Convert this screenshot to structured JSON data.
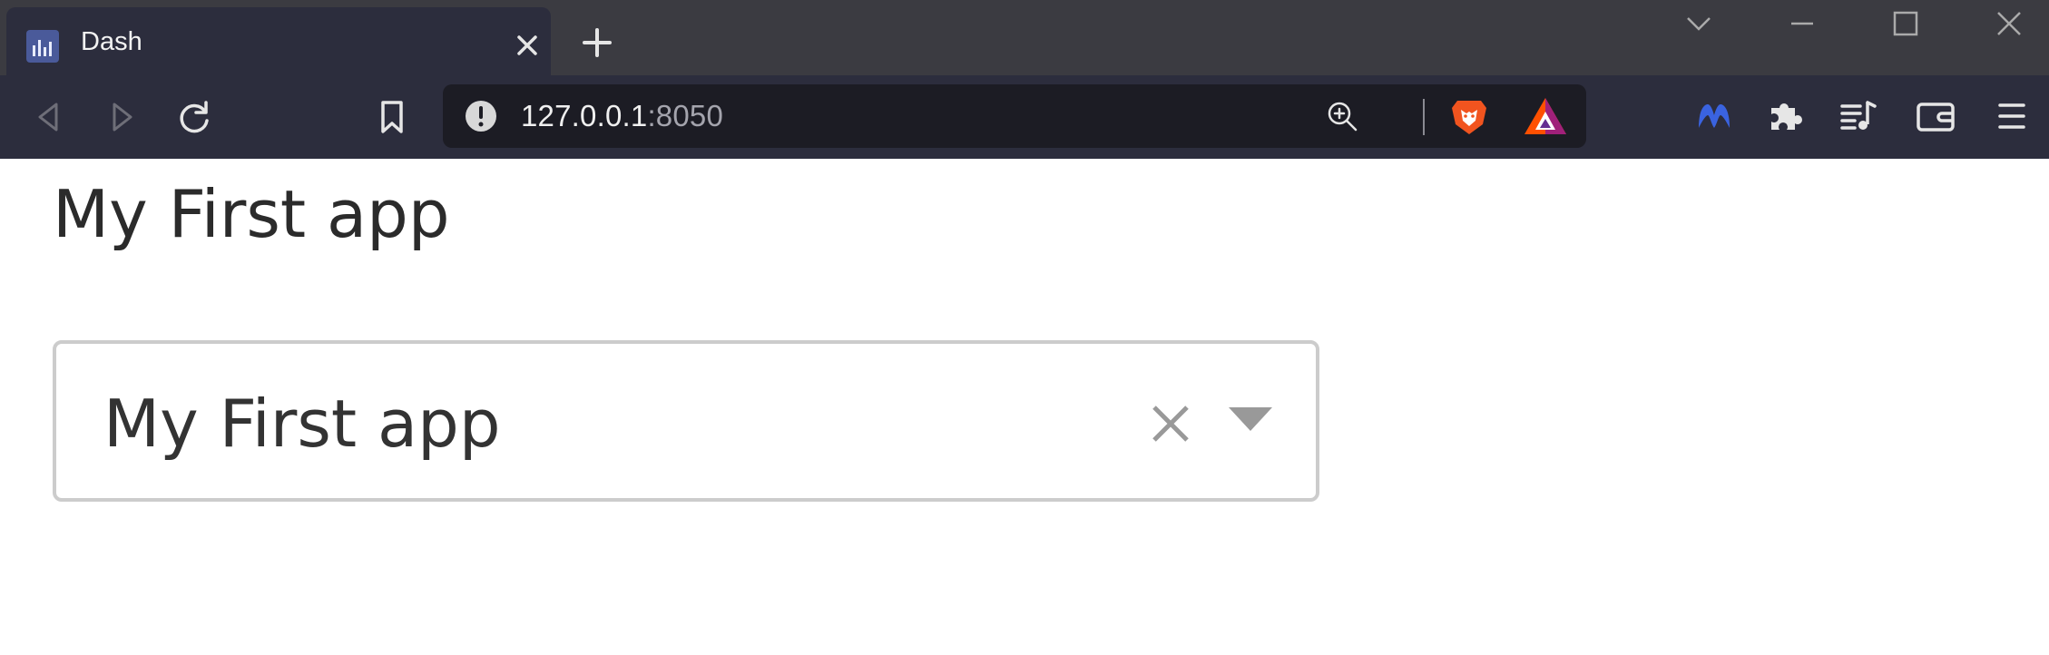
{
  "browser": {
    "tab": {
      "title": "Dash",
      "favicon": "plotly-dash-icon"
    },
    "address": {
      "host": "127.0.0.1",
      "port": ":8050"
    },
    "icons": {
      "back": "back-icon",
      "forward": "forward-icon",
      "reload": "reload-icon",
      "bookmark": "bookmark-icon",
      "site_info": "info-icon",
      "zoom": "zoom-icon",
      "brave_shields": "brave-lion-icon",
      "brave_rewards": "bat-triangle-icon",
      "extensions": [
        "malwarebytes-icon",
        "puzzle-icon",
        "media-queue-icon",
        "wallet-icon",
        "menu-icon"
      ]
    }
  },
  "page": {
    "title": "My First app",
    "dropdown": {
      "value": "My First app"
    }
  }
}
